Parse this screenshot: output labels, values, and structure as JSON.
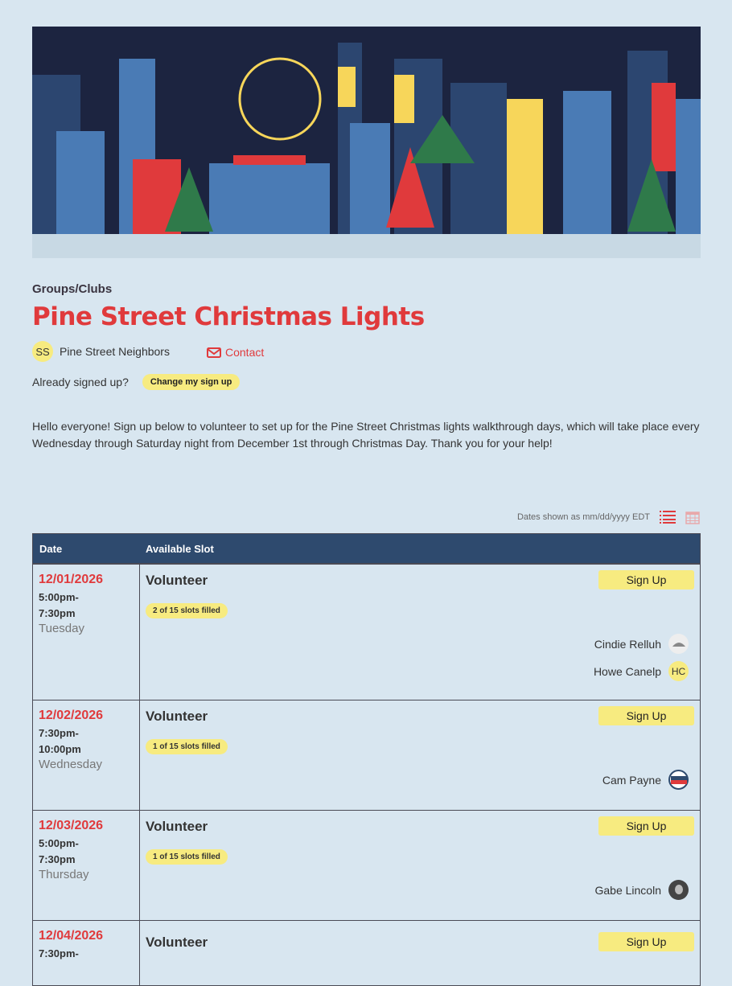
{
  "header": {
    "category": "Groups/Clubs",
    "title": "Pine Street Christmas Lights",
    "organizer_initials": "SS",
    "organizer": "Pine Street Neighbors",
    "contact_label": "Contact",
    "already_label": "Already signed up?",
    "change_label": "Change my sign up"
  },
  "description": "Hello everyone! Sign up below to volunteer to set up for the Pine Street Christmas lights walkthrough days, which will take place every Wednesday through Saturday night from December 1st through Christmas Day. Thank you for your help!",
  "table": {
    "date_format": "Dates shown as mm/dd/yyyy EDT",
    "col_date": "Date",
    "col_slot": "Available Slot",
    "rows": [
      {
        "date": "12/01/2026",
        "start": "5:00pm-",
        "end": "7:30pm",
        "day": "Tuesday",
        "slot": "Volunteer",
        "filled": "2 of 15 slots filled",
        "button": "Sign Up",
        "people": [
          {
            "name": "Cindie Relluh",
            "avatar": "image"
          },
          {
            "name": "Howe Canelp",
            "initials": "HC"
          }
        ]
      },
      {
        "date": "12/02/2026",
        "start": "7:30pm-",
        "end": "10:00pm",
        "day": "Wednesday",
        "slot": "Volunteer",
        "filled": "1 of 15 slots filled",
        "button": "Sign Up",
        "people": [
          {
            "name": "Cam Payne",
            "avatar": "vote"
          }
        ]
      },
      {
        "date": "12/03/2026",
        "start": "5:00pm-",
        "end": "7:30pm",
        "day": "Thursday",
        "slot": "Volunteer",
        "filled": "1 of 15 slots filled",
        "button": "Sign Up",
        "people": [
          {
            "name": "Gabe Lincoln",
            "avatar": "portrait"
          }
        ]
      },
      {
        "date": "12/04/2026",
        "start": "7:30pm-",
        "slot": "Volunteer",
        "button": "Sign Up"
      }
    ]
  },
  "colors": {
    "accent": "#e03a3c",
    "header": "#2e4a6e",
    "highlight": "#f7eb80",
    "background": "#d8e6f0"
  }
}
